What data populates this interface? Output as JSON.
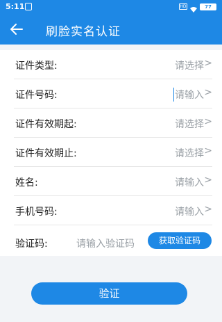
{
  "status_bar": {
    "time": "5:11",
    "net": "HD",
    "battery": "77"
  },
  "app_bar": {
    "title": "刷脸实名认证"
  },
  "form": {
    "rows": [
      {
        "label": "证件类型:",
        "value": "请选择",
        "chevron": ">"
      },
      {
        "label": "证件号码:",
        "value": "请输入",
        "chevron": ">"
      },
      {
        "label": "证件有效期起:",
        "value": "请选择",
        "chevron": ">"
      },
      {
        "label": "证件有效期止:",
        "value": "请选择",
        "chevron": ">"
      },
      {
        "label": "姓名:",
        "value": "请输入",
        "chevron": ">"
      },
      {
        "label": "手机号码:",
        "value": "请输入",
        "chevron": ">"
      }
    ],
    "code": {
      "label": "验证码:",
      "placeholder": "请输入验证码",
      "button": "获取验证码"
    }
  },
  "submit": {
    "label": "验证"
  },
  "colors": {
    "primary": "#1e88e5",
    "placeholder": "#9aa0a6",
    "background": "#f2f4f7"
  }
}
